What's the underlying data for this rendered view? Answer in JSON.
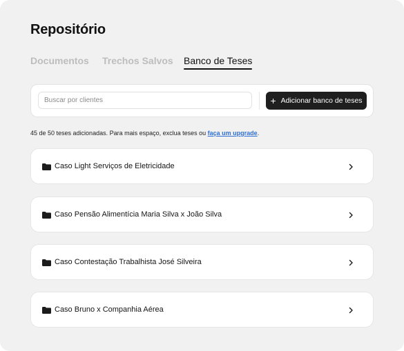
{
  "page": {
    "title": "Repositório"
  },
  "tabs": [
    {
      "label": "Documentos",
      "active": false
    },
    {
      "label": "Trechos Salvos",
      "active": false
    },
    {
      "label": "Banco de Teses",
      "active": true
    }
  ],
  "toolbar": {
    "search_placeholder": "Buscar por clientes",
    "search_value": "",
    "add_button_label": "Adicionar banco de teses",
    "add_button_icon": "plus-icon"
  },
  "info": {
    "text": "45 de 50 teses adicionadas. Para mais espaço, exclua teses ou ",
    "link_text": "faça um upgrade",
    "suffix": ".",
    "used": 45,
    "limit": 50
  },
  "cases": [
    {
      "label": "Caso Light Serviços de Eletricidade",
      "icon": "folder-icon"
    },
    {
      "label": "Caso Pensão Alimentícia Maria Silva x João Silva",
      "icon": "folder-icon"
    },
    {
      "label": "Caso Contestação Trabalhista José Silveira",
      "icon": "folder-icon"
    },
    {
      "label": "Caso Bruno x Companhia Aérea",
      "icon": "folder-icon"
    }
  ],
  "colors": {
    "panel_bg": "#f1f1f1",
    "button_bg": "#1f1f1f",
    "link": "#2f6fd6",
    "inactive_tab": "#bdbdbd"
  }
}
